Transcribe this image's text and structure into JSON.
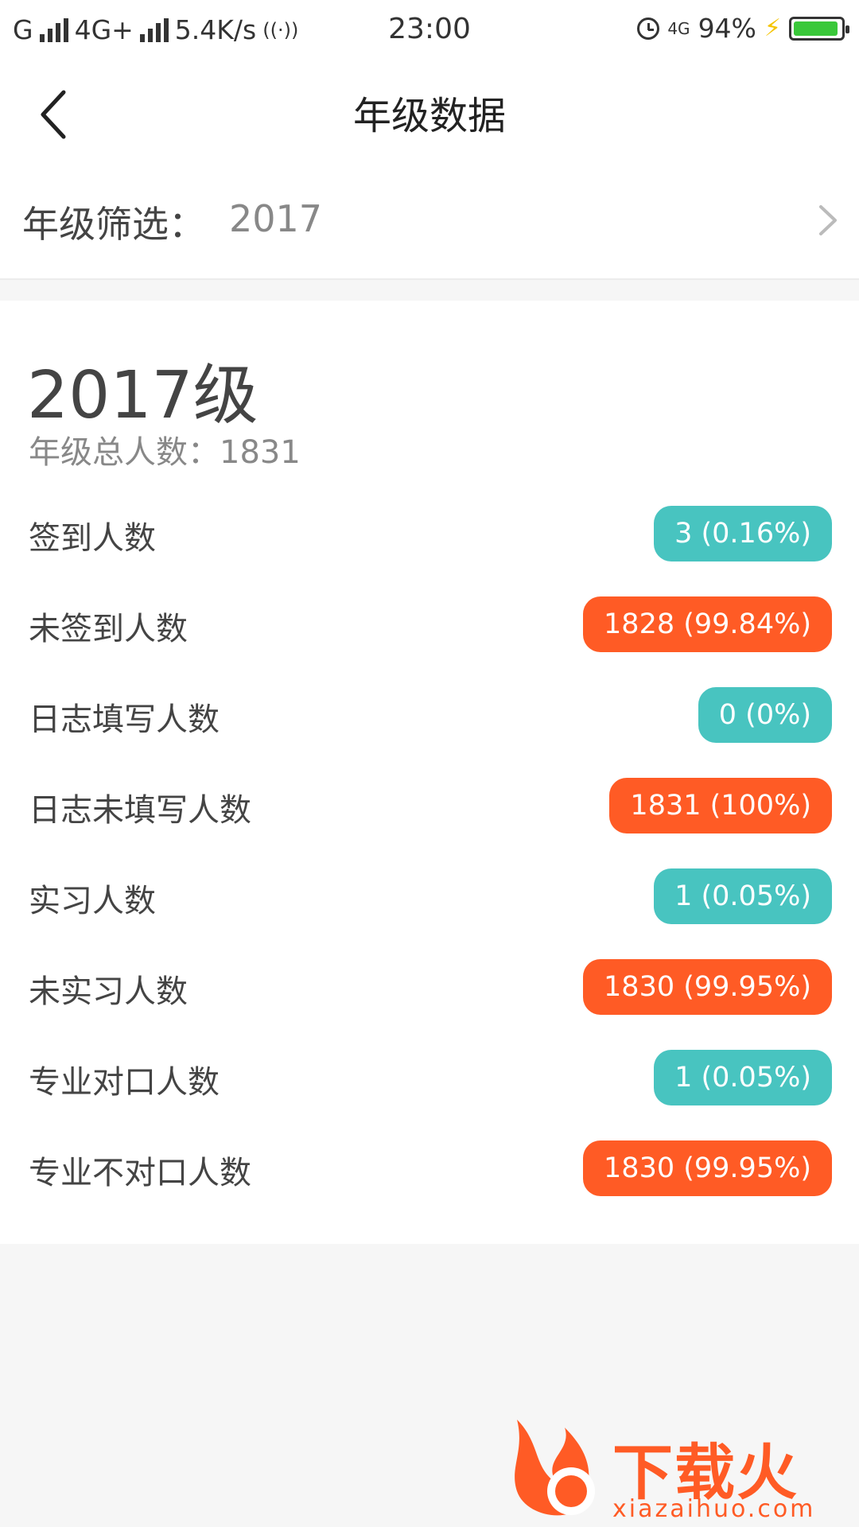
{
  "status_bar": {
    "carrier1": "G",
    "carrier2": "4G+",
    "speed": "5.4K/s",
    "time": "23:00",
    "network": "4G",
    "battery": "94%",
    "battery_level": 0.94,
    "battery_color": "#3ac83a"
  },
  "header": {
    "title": "年级数据"
  },
  "filter": {
    "label": "年级筛选：",
    "value": "2017"
  },
  "summary": {
    "grade": "2017级",
    "total_label": "年级总人数：",
    "total_value": "1831"
  },
  "stats": [
    {
      "label": "签到人数",
      "value": "3 (0.16%)",
      "color": "#48c4c0"
    },
    {
      "label": "未签到人数",
      "value": "1828 (99.84%)",
      "color": "#ff5b25"
    },
    {
      "label": "日志填写人数",
      "value": "0 (0%)",
      "color": "#48c4c0"
    },
    {
      "label": "日志未填写人数",
      "value": "1831 (100%)",
      "color": "#ff5b25"
    },
    {
      "label": "实习人数",
      "value": "1 (0.05%)",
      "color": "#48c4c0"
    },
    {
      "label": "未实习人数",
      "value": "1830 (99.95%)",
      "color": "#ff5b25"
    },
    {
      "label": "专业对口人数",
      "value": "1 (0.05%)",
      "color": "#48c4c0"
    },
    {
      "label": "专业不对口人数",
      "value": "1830 (99.95%)",
      "color": "#ff5b25"
    }
  ],
  "watermark": {
    "text": "下载火",
    "url": "xiazaihuo.com"
  },
  "colors": {
    "teal": "#48c4c0",
    "orange": "#ff5b25"
  }
}
